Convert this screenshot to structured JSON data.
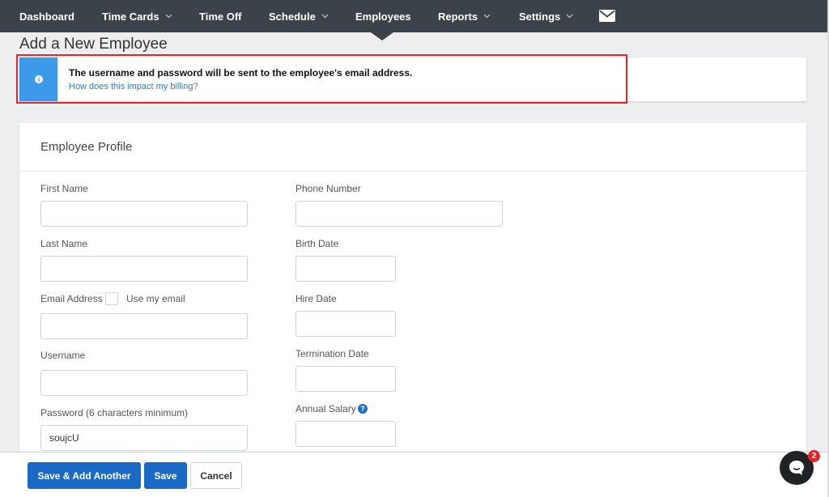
{
  "nav": {
    "items": [
      {
        "label": "Dashboard",
        "dropdown": false
      },
      {
        "label": "Time Cards",
        "dropdown": true
      },
      {
        "label": "Time Off",
        "dropdown": false
      },
      {
        "label": "Schedule",
        "dropdown": true
      },
      {
        "label": "Employees",
        "dropdown": false,
        "active": true
      },
      {
        "label": "Reports",
        "dropdown": true
      },
      {
        "label": "Settings",
        "dropdown": true
      }
    ],
    "mail_icon": "envelope-icon"
  },
  "page": {
    "title": "Add a New Employee"
  },
  "alert": {
    "icon": "info-icon",
    "message": "The username and password will be sent to the employee's email address.",
    "link": "How does this impact my billing?"
  },
  "profile": {
    "title": "Employee Profile",
    "left": [
      {
        "label": "First Name",
        "value": ""
      },
      {
        "label": "Last Name",
        "value": ""
      },
      {
        "label": "Email Address",
        "value": "",
        "checkbox_label": "Use my email"
      },
      {
        "label": "Username",
        "value": ""
      },
      {
        "label": "Password (6 characters minimum)",
        "value": "soujcU"
      }
    ],
    "right": [
      {
        "label": "Phone Number",
        "value": ""
      },
      {
        "label": "Birth Date",
        "value": ""
      },
      {
        "label": "Hire Date",
        "value": ""
      },
      {
        "label": "Termination Date",
        "value": ""
      },
      {
        "label": "Annual Salary",
        "value": "",
        "help_icon": "?"
      }
    ]
  },
  "footer": {
    "save_add_another": "Save & Add Another",
    "save": "Save",
    "cancel": "Cancel"
  },
  "chat": {
    "badge": "2"
  },
  "colors": {
    "nav_bg": "#3b4249",
    "primary": "#1a69c4",
    "alert_accent": "#3d9ae8",
    "highlight": "#e2262a"
  }
}
